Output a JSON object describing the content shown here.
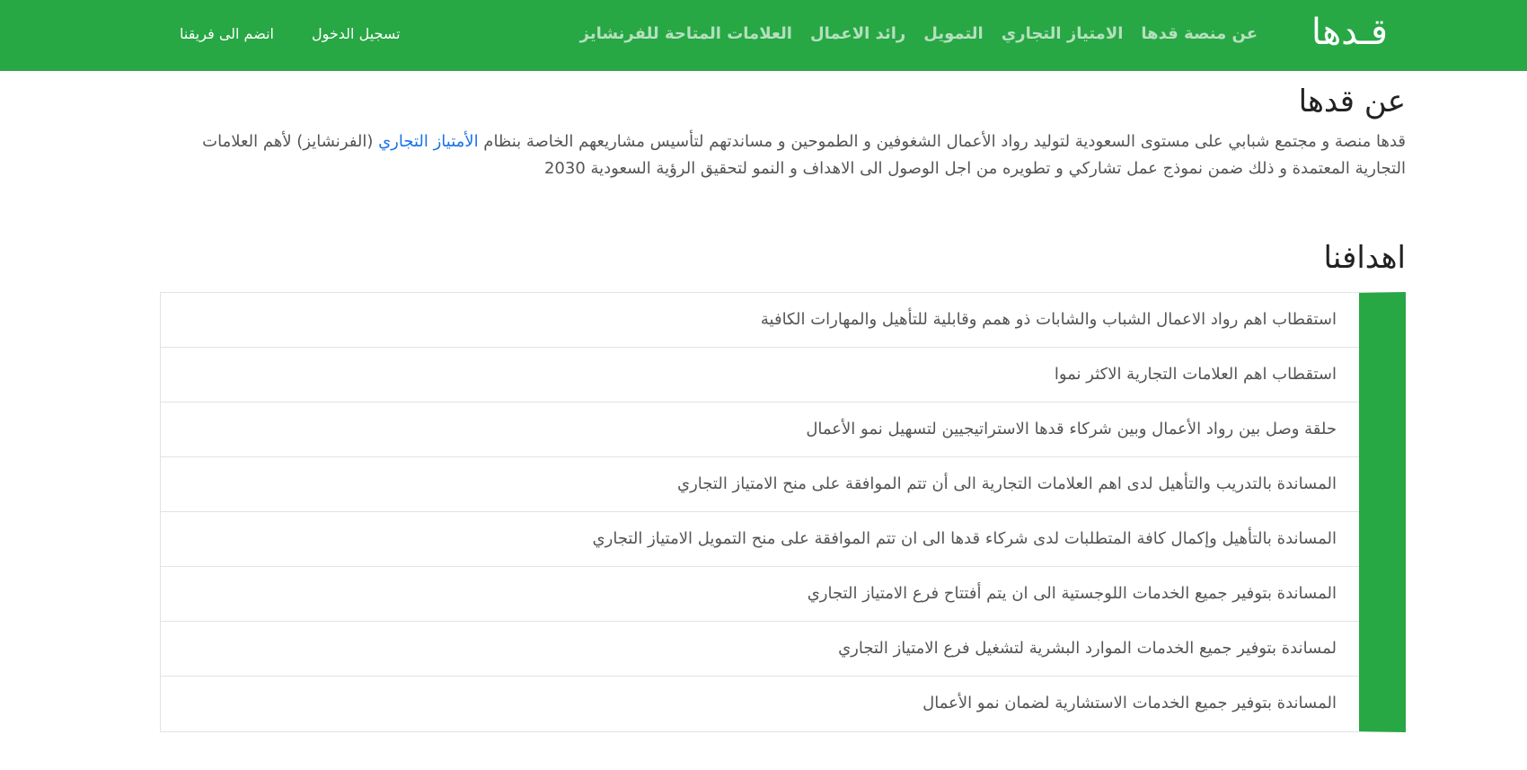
{
  "navbar": {
    "brand": "قـدها",
    "links": [
      "عن منصة قدها",
      "الامتياز التجاري",
      "التمويل",
      "رائد الاعمال",
      "العلامات المتاحة للفرنشايز"
    ],
    "login_label": "تسجيل الدخول",
    "join_label": "انضم الى فريقنا",
    "background_color": "#28a745"
  },
  "about": {
    "title": "عن قدها",
    "text_before_link": "قدها منصة و مجتمع شبابي على مستوى السعودية لتوليد رواد الأعمال الشغوفين و الطموحين و مساندتهم لتأسيس مشاريعهم الخاصة بنظام ",
    "link_text": "الأمتياز التجاري",
    "text_after_link": " (الفرنشايز) لأهم العلامات التجارية المعتمدة و ذلك ضمن نموذج عمل تشاركي و تطويره من اجل الوصول الى الاهداف و النمو لتحقيق الرؤية السعودية 2030",
    "link_color": "#1a73e8"
  },
  "goals": {
    "title": "اهدافنا",
    "items": [
      "استقطاب اهم رواد الاعمال الشباب والشابات ذو همم وقابلية للتأهيل والمهارات الكافية",
      "استقطاب اهم العلامات التجارية الاكثر نموا",
      "حلقة وصل بين رواد الأعمال وبين شركاء قدها الاستراتيجيين لتسهيل نمو الأعمال",
      "المساندة بالتدريب والتأهيل لدى اهم العلامات التجارية الى أن تتم الموافقة على منح الامتياز التجاري",
      "المساندة بالتأهيل وإكمال كافة المتطلبات لدى شركاء قدها الى ان تتم الموافقة على منح التمويل الامتياز التجاري",
      "المساندة بتوفير جميع الخدمات اللوجستية الى ان يتم أفتتاح فرع الامتياز التجاري",
      "لمساندة بتوفير جميع الخدمات الموارد البشرية لتشغيل فرع الامتياز التجاري",
      "المساندة بتوفير جميع الخدمات الاستشارية لضمان نمو الأعمال"
    ],
    "accent_color": "#28a745"
  }
}
